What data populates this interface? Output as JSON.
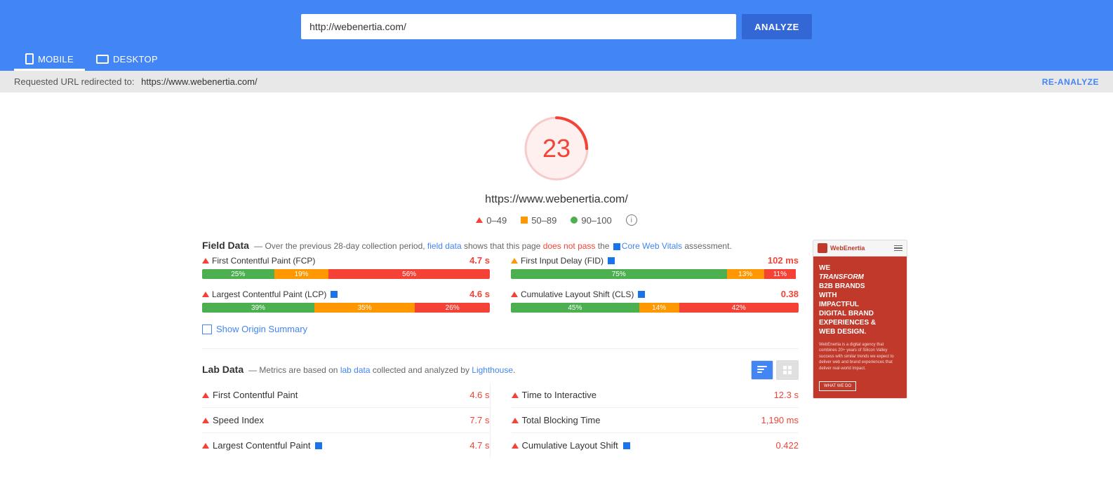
{
  "header": {
    "url_value": "http://webenertia.com/",
    "analyze_label": "ANALYZE",
    "tabs": [
      {
        "id": "mobile",
        "label": "MOBILE",
        "active": true,
        "icon": "mobile-icon"
      },
      {
        "id": "desktop",
        "label": "DESKTOP",
        "active": false,
        "icon": "desktop-icon"
      }
    ]
  },
  "redirect_bar": {
    "prefix": "Requested URL redirected to:",
    "url": "https://www.webenertia.com/",
    "reanalyze_label": "RE-ANALYZE"
  },
  "score": {
    "value": "23",
    "url": "https://www.webenertia.com/",
    "legend": [
      {
        "range": "0–49",
        "type": "triangle",
        "color": "#f44336"
      },
      {
        "range": "50–89",
        "type": "square",
        "color": "#ff9800"
      },
      {
        "range": "90–100",
        "type": "circle",
        "color": "#4caf50"
      }
    ]
  },
  "field_data": {
    "title": "Field Data",
    "description_parts": [
      "— Over the previous 28-day collection period,",
      "field data",
      "shows that this page",
      "does not pass",
      "the",
      "Core Web Vitals",
      "assessment."
    ],
    "metrics": [
      {
        "label": "First Contentful Paint (FCP)",
        "value": "4.7 s",
        "value_color": "red",
        "bars": [
          {
            "pct": 25,
            "label": "25%",
            "color": "green"
          },
          {
            "pct": 19,
            "label": "19%",
            "color": "orange"
          },
          {
            "pct": 56,
            "label": "56%",
            "color": "red"
          }
        ]
      },
      {
        "label": "First Input Delay (FID)",
        "value": "102 ms",
        "value_color": "red",
        "bars": [
          {
            "pct": 75,
            "label": "75%",
            "color": "green"
          },
          {
            "pct": 13,
            "label": "13%",
            "color": "orange"
          },
          {
            "pct": 11,
            "label": "11%",
            "color": "red"
          }
        ]
      },
      {
        "label": "Largest Contentful Paint (LCP)",
        "value": "4.6 s",
        "value_color": "red",
        "bars": [
          {
            "pct": 39,
            "label": "39%",
            "color": "green"
          },
          {
            "pct": 35,
            "label": "35%",
            "color": "orange"
          },
          {
            "pct": 26,
            "label": "26%",
            "color": "red"
          }
        ]
      },
      {
        "label": "Cumulative Layout Shift (CLS)",
        "value": "0.38",
        "value_color": "red",
        "bars": [
          {
            "pct": 45,
            "label": "45%",
            "color": "green"
          },
          {
            "pct": 14,
            "label": "14%",
            "color": "orange"
          },
          {
            "pct": 42,
            "label": "42%",
            "color": "red"
          }
        ]
      }
    ],
    "show_origin_label": "Show Origin Summary"
  },
  "lab_data": {
    "title": "Lab Data",
    "description_parts": [
      "— Metrics are based on",
      "lab data",
      "collected and analyzed by",
      "Lighthouse",
      "."
    ],
    "metrics_left": [
      {
        "label": "First Contentful Paint",
        "value": "4.6 s",
        "value_color": "red"
      },
      {
        "label": "Speed Index",
        "value": "7.7 s",
        "value_color": "red"
      },
      {
        "label": "Largest Contentful Paint",
        "value": "4.7 s",
        "value_color": "red"
      }
    ],
    "metrics_right": [
      {
        "label": "Time to Interactive",
        "value": "12.3 s",
        "value_color": "red"
      },
      {
        "label": "Total Blocking Time",
        "value": "1,190 ms",
        "value_color": "red"
      },
      {
        "label": "Cumulative Layout Shift",
        "value": "0.422",
        "value_color": "red"
      }
    ]
  },
  "preview": {
    "logo_text": "WebEnertia",
    "headline_line1": "WE",
    "headline_line2": "TRANSFORM",
    "headline_line3": "B2B BRANDS",
    "headline_line4": "WITH",
    "headline_line5": "IMPACTFUL",
    "headline_line6": "DIGITAL BRAND",
    "headline_line7": "EXPERIENCES &",
    "headline_line8": "WEB DESIGN.",
    "subtext": "WebEnertia is a digital agency that combines 20+ years of Silicon Valley success with similar trends we expect to deliver web and brand experiences that deliver real-world impact.",
    "btn_label": "WHAT WE DO"
  },
  "colors": {
    "header_bg": "#4285f4",
    "analyze_btn": "#3367d6",
    "score_red": "#f44336",
    "bar_green": "#4caf50",
    "bar_orange": "#ff9800",
    "bar_red": "#f44336",
    "link_blue": "#4285f4",
    "preview_red": "#c0392b"
  }
}
